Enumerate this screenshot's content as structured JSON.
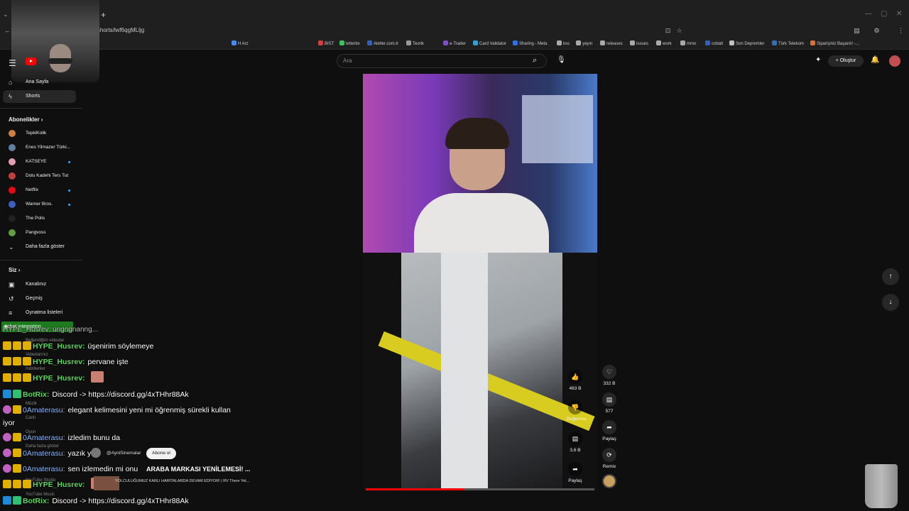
{
  "browser": {
    "url": "m/shorts/lwf6qgMLljg",
    "new_tab": "+",
    "tab_dropdown": "⌄",
    "window_controls": [
      "—",
      "▢",
      "✕"
    ],
    "bookmarks": [
      "H Arz",
      "BIST",
      "letterbx",
      "Aletler.com.tr",
      "Teorik",
      "e-Trader",
      "Card Validator",
      "Sharing - Meta",
      "kss",
      "yayın",
      "releases",
      "issues",
      "work",
      "mmo",
      "cobalt",
      "Son Depremler",
      "Türk Telekom",
      "Siparişiniz Başarılı! -..."
    ]
  },
  "header": {
    "search_placeholder": "Ara",
    "create_label": "Oluştur"
  },
  "sidebar": {
    "home_label": "Ana Sayfa",
    "shorts_label": "Shorts",
    "subscriptions_title": "Abonelikler",
    "subscriptions": [
      {
        "name": "TepkiKolik",
        "color": "#d08040",
        "live": false
      },
      {
        "name": "Enes Yilmazer Türki...",
        "color": "#6080a0",
        "live": false
      },
      {
        "name": "KATSEYE",
        "color": "#e0a0b0",
        "live": true
      },
      {
        "name": "Dolu Kadehi Ters Tut",
        "color": "#c04040",
        "live": false
      },
      {
        "name": "Netflix",
        "color": "#e50914",
        "live": true
      },
      {
        "name": "Warner Bros.",
        "color": "#3a60c0",
        "live": true
      },
      {
        "name": "The Polis",
        "color": "#222222",
        "live": false
      },
      {
        "name": "Pangvoss",
        "color": "#60a040",
        "live": false
      }
    ],
    "show_more": "Daha fazla göster",
    "you_title": "Siz",
    "you_items": [
      "Kanalınız",
      "Geçmiş",
      "Oynatma listeleri"
    ],
    "ghost_items": [
      "Beğendiğim videolar",
      "Videolarınız",
      "İndirilenler",
      "Müzik",
      "Canlı",
      "Oyun",
      "Daha fazla göster",
      "YouTube Studio",
      "YouTube Music"
    ]
  },
  "chat": {
    "integration_label": "chat integration",
    "messages": [
      {
        "user": "HYPE_Husrev:",
        "text": "üşenirim söylemeye",
        "style": "g",
        "badges": [
          "y",
          "y",
          "y"
        ]
      },
      {
        "user": "HYPE_Husrev:",
        "text": "pervane işte",
        "style": "g",
        "badges": [
          "y",
          "y",
          "y"
        ]
      },
      {
        "user": "HYPE_Husrev:",
        "text": "",
        "style": "g",
        "badges": [
          "y",
          "y",
          "y"
        ],
        "emote": true
      },
      {
        "user": "BotRix:",
        "text": "Discord -> https://discord.gg/4xTHhr88Ak",
        "style": "g",
        "badges": [
          "t",
          "g"
        ]
      },
      {
        "user": "0Amaterasu:",
        "text": "elegant kelimesini yeni mi öğrenmiş sürekli kullan",
        "style": "b",
        "badges": [
          "p",
          "y"
        ]
      },
      {
        "user": "0Amaterasu:",
        "text": "izledim bunu da",
        "style": "b",
        "badges": [
          "p",
          "y"
        ]
      },
      {
        "user": "0Amaterasu:",
        "text": "yazık ya",
        "style": "b",
        "badges": [
          "p",
          "y"
        ]
      },
      {
        "user": "0Amaterasu:",
        "text": "sen izlemedin mi onu",
        "style": "b",
        "badges": [
          "p",
          "y"
        ]
      },
      {
        "user": "HYPE_Husrev:",
        "text": "",
        "style": "g",
        "badges": [
          "y",
          "y",
          "y"
        ],
        "emote": true
      },
      {
        "user": "BotRix:",
        "text": "Discord -> https://discord.gg/4xTHhr88Ak",
        "style": "g",
        "badges": [
          "t",
          "g"
        ]
      }
    ],
    "wrap_text": "iyor",
    "top_partial": "HYPE_Husrev: ungngnanng..."
  },
  "short": {
    "channel_handle": "@AyniSinemalar",
    "subscribe_label": "Abone ol",
    "title_overlay": "ARABA MARKASI YENİLEMESİ! ...",
    "subtitle_overlay": "YOLCULUĞUMUZ KARLI HARİTALARDA DEVAM EDİYOR! | RV There Yet...",
    "progress": 0.43,
    "overlay_actions": [
      {
        "icon": "thumb-up-icon",
        "label": "463 B"
      },
      {
        "icon": "thumb-down-icon",
        "label": "Beğenme"
      },
      {
        "icon": "comment-icon",
        "label": "3,6 B"
      },
      {
        "icon": "share-icon",
        "label": "Paylaş"
      }
    ],
    "actions": [
      {
        "icon": "heart-icon",
        "label": "332 B"
      },
      {
        "icon": "comment-icon",
        "label": "577"
      },
      {
        "icon": "share-icon",
        "label": "Paylaş"
      },
      {
        "icon": "remix-icon",
        "label": "Remix"
      }
    ]
  }
}
